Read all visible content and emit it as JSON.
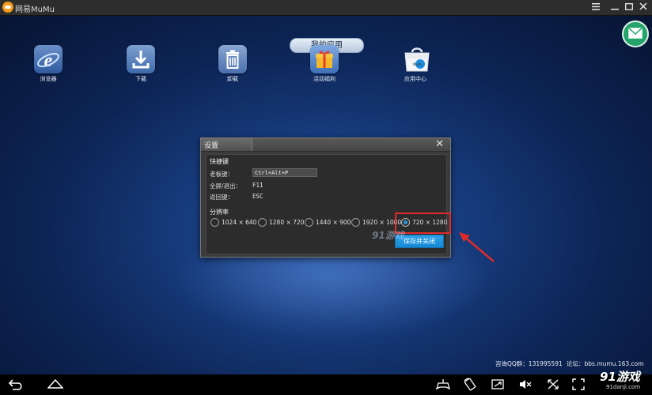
{
  "window": {
    "title": "网易MuMu",
    "menu_icon": "menu-icon",
    "minimize_icon": "minimize-icon",
    "maximize_icon": "maximize-icon",
    "close_icon": "close-icon"
  },
  "desktop": {
    "section_label": "我的应用",
    "apps": [
      {
        "label": "浏览器",
        "icon": "browser-icon",
        "color": "#3a6fb7"
      },
      {
        "label": "下载",
        "icon": "download-icon",
        "color": "#4d7fc2"
      },
      {
        "label": "卸载",
        "icon": "trash-icon",
        "color": "#5a82bb"
      },
      {
        "label": "活动福利",
        "icon": "gift-icon",
        "color": "#5b8fcd"
      },
      {
        "label": "应用中心",
        "icon": "app-store-bag-icon",
        "color": "#ffffff"
      }
    ],
    "message_icon": "envelope-icon",
    "watermark": "91游戏"
  },
  "dialog": {
    "title": "设置",
    "shortcut_section": "快捷键",
    "boss_key_label": "老板键：",
    "boss_key_value": "Ctrl+Alt+P",
    "fullscreen_label": "全屏/退出：",
    "fullscreen_value": "F11",
    "back_label": "返回键：",
    "back_value": "ESC",
    "resolution_section": "分辨率",
    "resolutions": [
      {
        "label": "1024 × 640",
        "selected": false
      },
      {
        "label": "1280 × 720",
        "selected": false
      },
      {
        "label": "1440 × 900",
        "selected": false
      },
      {
        "label": "1920 × 1080",
        "selected": false
      },
      {
        "label": "720 × 1280",
        "selected": true
      }
    ],
    "save_button": "保存并关闭"
  },
  "footer": {
    "qq_group": "咨询QQ群：131995591",
    "forum": "论坛：bbs.mumu.163.com"
  },
  "navbar": {
    "icons": [
      "back-arrow-icon",
      "home-icon",
      "gamepad-icon",
      "rotate-icon",
      "screenshot-icon",
      "volume-icon",
      "shake-icon",
      "fullscreen-icon"
    ]
  },
  "brand": {
    "logo": "91游戏",
    "url": "91danji.com"
  },
  "colors": {
    "accent": "#1487d3",
    "highlight": "#e02a2a",
    "dialog_bg": "#3b3b3b"
  }
}
